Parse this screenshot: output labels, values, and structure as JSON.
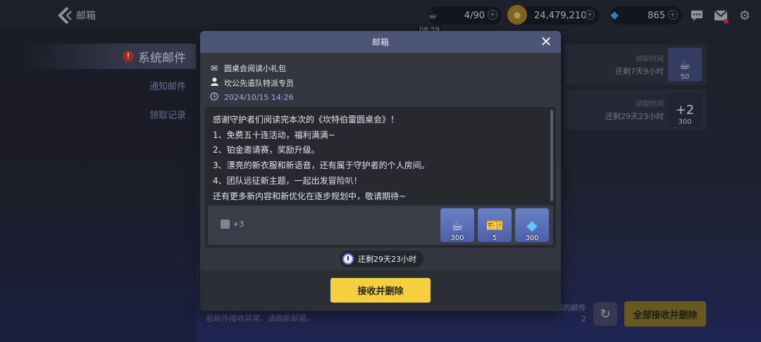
{
  "header": {
    "title": "邮箱"
  },
  "resources": [
    {
      "icon": "coffee-icon",
      "value": "4/90",
      "timer": "08:59"
    },
    {
      "icon": "gold-coin-icon",
      "value": "24,479,210"
    },
    {
      "icon": "gem-icon",
      "value": "865"
    }
  ],
  "sidebar": {
    "active": "系统邮件",
    "items": [
      "通知邮件",
      "领取记录"
    ]
  },
  "mail_list": [
    {
      "label": "领取时间",
      "remain": "还剩7天9小时",
      "thumb_icon": "coffee-icon",
      "thumb_count": "50"
    },
    {
      "label": "领取时间",
      "remain": "还剩29天23小时",
      "thumb_text": "+2",
      "thumb_count": "300"
    }
  ],
  "footer": {
    "note": "若邮件接收异常，请刷新邮箱。",
    "count_label": "领的邮件",
    "count": "2",
    "receive_all": "全部接收并删除"
  },
  "modal": {
    "title": "邮箱",
    "subject": "圆桌会阅读小礼包",
    "sender": "坎公先遣队特派专员",
    "date": "2024/10/15 14:26",
    "body_lines": [
      "感谢守护者们阅读完本次的《坎特伯雷圆桌会》！",
      "1、免费五十连活动，福利满满~",
      "2、铂金邀请赛，奖励升级。",
      "3、漂亮的新衣服和新语音，还有属于守护者的个人房间。",
      "4、团队远征新主题，一起出发冒险叭！",
      "还有更多新内容和新优化在逐步规划中，敬请期待~"
    ],
    "extra_attachments": "+3",
    "attachments": [
      {
        "icon": "coffee-cup-icon",
        "qty": "300"
      },
      {
        "icon": "ticket-icon",
        "qty": "5"
      },
      {
        "icon": "diamond-icon",
        "qty": "300"
      }
    ],
    "remaining": "还剩29天23小时",
    "receive_button": "接收并删除"
  }
}
